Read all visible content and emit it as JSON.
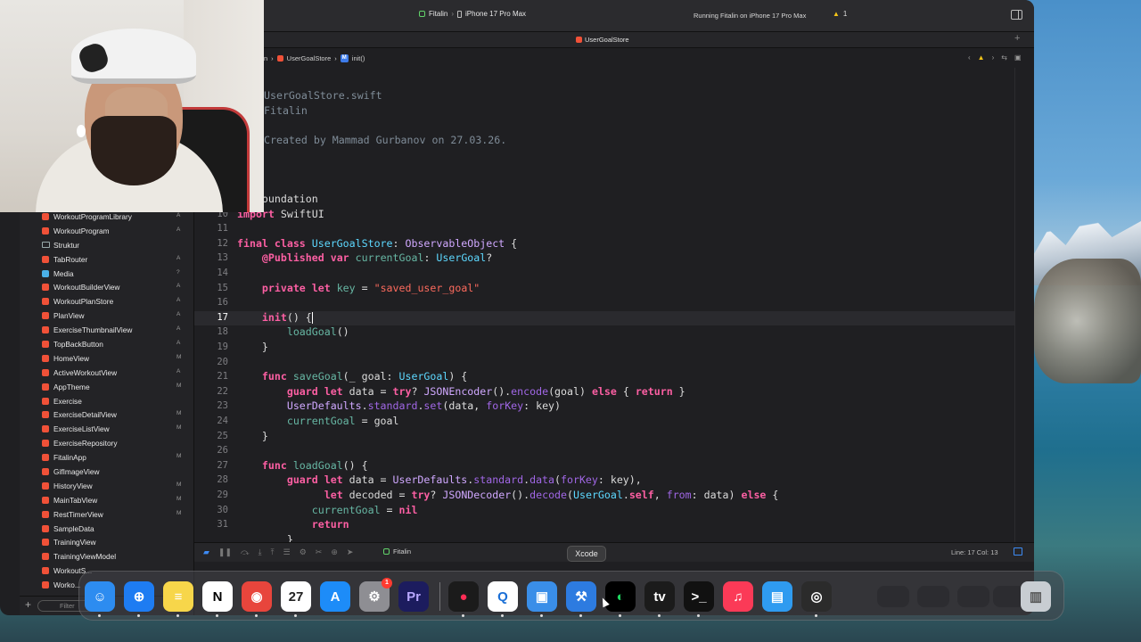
{
  "titlebar": {
    "scheme_app": "Fitalin",
    "scheme_device": "iPhone 17 Pro Max",
    "run_status": "Running Fitalin on iPhone 17 Pro Max",
    "warning_count": "1"
  },
  "tab": {
    "label": "UserGoalStore"
  },
  "jumpbar": {
    "prefix": "n",
    "file": "UserGoalStore",
    "symbol_badge": "M",
    "symbol": "init()"
  },
  "navigator": {
    "items": [
      {
        "label": "WorkoutProgramLibrary",
        "status": "A",
        "kind": "swift"
      },
      {
        "label": "WorkoutProgram",
        "status": "A",
        "kind": "swift"
      },
      {
        "label": "Struktur",
        "status": "",
        "kind": "folder"
      },
      {
        "label": "TabRouter",
        "status": "A",
        "kind": "swift"
      },
      {
        "label": "Media",
        "status": "?",
        "kind": "assets"
      },
      {
        "label": "WorkoutBuilderView",
        "status": "A",
        "kind": "swift"
      },
      {
        "label": "WorkoutPlanStore",
        "status": "A",
        "kind": "swift"
      },
      {
        "label": "PlanView",
        "status": "A",
        "kind": "swift"
      },
      {
        "label": "ExerciseThumbnailView",
        "status": "A",
        "kind": "swift"
      },
      {
        "label": "TopBackButton",
        "status": "A",
        "kind": "swift"
      },
      {
        "label": "HomeView",
        "status": "M",
        "kind": "swift"
      },
      {
        "label": "ActiveWorkoutView",
        "status": "A",
        "kind": "swift"
      },
      {
        "label": "AppTheme",
        "status": "M",
        "kind": "swift"
      },
      {
        "label": "Exercise",
        "status": "",
        "kind": "swift"
      },
      {
        "label": "ExerciseDetailView",
        "status": "M",
        "kind": "swift"
      },
      {
        "label": "ExerciseListView",
        "status": "M",
        "kind": "swift"
      },
      {
        "label": "ExerciseRepository",
        "status": "",
        "kind": "swift"
      },
      {
        "label": "FitalinApp",
        "status": "M",
        "kind": "swift"
      },
      {
        "label": "GifImageView",
        "status": "",
        "kind": "swift"
      },
      {
        "label": "HistoryView",
        "status": "M",
        "kind": "swift"
      },
      {
        "label": "MainTabView",
        "status": "M",
        "kind": "swift"
      },
      {
        "label": "RestTimerView",
        "status": "M",
        "kind": "swift"
      },
      {
        "label": "SampleData",
        "status": "",
        "kind": "swift"
      },
      {
        "label": "TrainingView",
        "status": "",
        "kind": "swift"
      },
      {
        "label": "TrainingViewModel",
        "status": "",
        "kind": "swift"
      },
      {
        "label": "WorkoutS...",
        "status": "",
        "kind": "swift"
      },
      {
        "label": "Worko...",
        "status": "",
        "kind": "swift"
      }
    ],
    "filter_placeholder": "Filter"
  },
  "editor": {
    "header": [
      {
        "text": "UserGoalStore.swift",
        "top": 0
      },
      {
        "text": "Fitalin",
        "top": 1
      }
    ],
    "created": "Created by Mammad Gurbanov on 27.03.26.",
    "lines": [
      {
        "n": "",
        "html": "<span class='kw'>rt</span> Foundation"
      },
      {
        "n": "10",
        "html": "<span class='kw'>import</span> SwiftUI"
      },
      {
        "n": "11",
        "html": ""
      },
      {
        "n": "12",
        "html": "<span class='kw'>final class</span> <span class='ty'>UserGoalStore</span>: <span class='ty2'>ObservableObject</span> {"
      },
      {
        "n": "13",
        "html": "    <span class='kw'>@Published</span> <span class='kw'>var</span> <span class='fn'>currentGoal</span>: <span class='ty'>UserGoal</span>?"
      },
      {
        "n": "14",
        "html": ""
      },
      {
        "n": "15",
        "html": "    <span class='kw'>private let</span> <span class='fn'>key</span> = <span class='str'>\"saved_user_goal\"</span>"
      },
      {
        "n": "16",
        "html": ""
      },
      {
        "n": "17",
        "html": "    <span class='kw'>init</span>() {<span class='cursor'></span>",
        "current": true
      },
      {
        "n": "18",
        "html": "        <span class='fn'>loadGoal</span>()"
      },
      {
        "n": "19",
        "html": "    }"
      },
      {
        "n": "20",
        "html": ""
      },
      {
        "n": "21",
        "html": "    <span class='kw'>func</span> <span class='fn'>saveGoal</span>(_ goal: <span class='ty'>UserGoal</span>) {"
      },
      {
        "n": "22",
        "html": "        <span class='kw'>guard let</span> data = <span class='kw'>try</span>? <span class='ty2'>JSONEncoder</span>().<span class='prop'>encode</span>(goal) <span class='kw'>else</span> { <span class='kw'>return</span> }"
      },
      {
        "n": "23",
        "html": "        <span class='ty2'>UserDefaults</span>.<span class='prop'>standard</span>.<span class='prop'>set</span>(data, <span class='prop'>forKey</span>: key)"
      },
      {
        "n": "24",
        "html": "        <span class='fn'>currentGoal</span> = goal"
      },
      {
        "n": "25",
        "html": "    }"
      },
      {
        "n": "26",
        "html": ""
      },
      {
        "n": "27",
        "html": "    <span class='kw'>func</span> <span class='fn'>loadGoal</span>() {"
      },
      {
        "n": "28",
        "html": "        <span class='kw'>guard let</span> data = <span class='ty2'>UserDefaults</span>.<span class='prop'>standard</span>.<span class='prop'>data</span>(<span class='prop'>forKey</span>: key),"
      },
      {
        "n": "29",
        "html": "              <span class='kw'>let</span> decoded = <span class='kw'>try</span>? <span class='ty2'>JSONDecoder</span>().<span class='prop'>decode</span>(<span class='ty'>UserGoal</span>.<span class='kw'>self</span>, <span class='prop'>from</span>: data) <span class='kw'>else</span> {"
      },
      {
        "n": "30",
        "html": "            <span class='fn'>currentGoal</span> = <span class='kw'>nil</span>"
      },
      {
        "n": "31",
        "html": "            <span class='kw'>return</span>"
      },
      {
        "n": "",
        "html": "        }"
      }
    ]
  },
  "debugbar": {
    "target": "Fitalin",
    "linecol": "Line: 17  Col: 13"
  },
  "tooltip": "Xcode",
  "dock": {
    "apps": [
      {
        "name": "finder-icon",
        "bg": "#2d8cf0",
        "glyph": "☺",
        "dot": true
      },
      {
        "name": "safari-icon",
        "bg": "#1e7cf2",
        "glyph": "⊕",
        "dot": true
      },
      {
        "name": "notes-icon",
        "bg": "#f7d64a",
        "glyph": "≡",
        "dot": true
      },
      {
        "name": "notion-icon",
        "bg": "#ffffff",
        "glyph": "N",
        "color": "#000",
        "dot": true
      },
      {
        "name": "chrome-icon",
        "bg": "#e8453c",
        "glyph": "◉",
        "dot": true
      },
      {
        "name": "calendar-icon",
        "bg": "#ffffff",
        "glyph": "27",
        "color": "#222",
        "dot": true
      },
      {
        "name": "app-store-icon",
        "bg": "#1d8cf8",
        "glyph": "A",
        "dot": false
      },
      {
        "name": "system-settings-icon",
        "bg": "#8e8e93",
        "glyph": "⚙",
        "dot": false,
        "badge": "1"
      },
      {
        "name": "premiere-icon",
        "bg": "#1c1c5e",
        "glyph": "Pr",
        "color": "#b8a7ff",
        "dot": false
      },
      {
        "name": "screen-recorder-icon",
        "bg": "#1b1b1b",
        "glyph": "●",
        "color": "#ff2d55",
        "dot": true
      },
      {
        "name": "quicktime-icon",
        "bg": "#ffffff",
        "glyph": "Q",
        "color": "#1a6fd6",
        "dot": true
      },
      {
        "name": "simulator-icon",
        "bg": "#3a8ee8",
        "glyph": "▣",
        "dot": true
      },
      {
        "name": "xcode-icon",
        "bg": "#2d7be0",
        "glyph": "⚒",
        "dot": true
      },
      {
        "name": "spotify-icon",
        "bg": "#000000",
        "glyph": "◐",
        "color": "#1ed760",
        "dot": true
      },
      {
        "name": "apple-tv-icon",
        "bg": "#1b1b1b",
        "glyph": "tv",
        "dot": true
      },
      {
        "name": "terminal-icon",
        "bg": "#111111",
        "glyph": ">_",
        "dot": true
      },
      {
        "name": "music-icon",
        "bg": "#fb3a57",
        "glyph": "♫",
        "dot": false
      },
      {
        "name": "keynote-icon",
        "bg": "#2f9bf0",
        "glyph": "▤",
        "dot": false
      },
      {
        "name": "obs-icon",
        "bg": "#2b2b2b",
        "glyph": "◎",
        "dot": true
      }
    ]
  }
}
